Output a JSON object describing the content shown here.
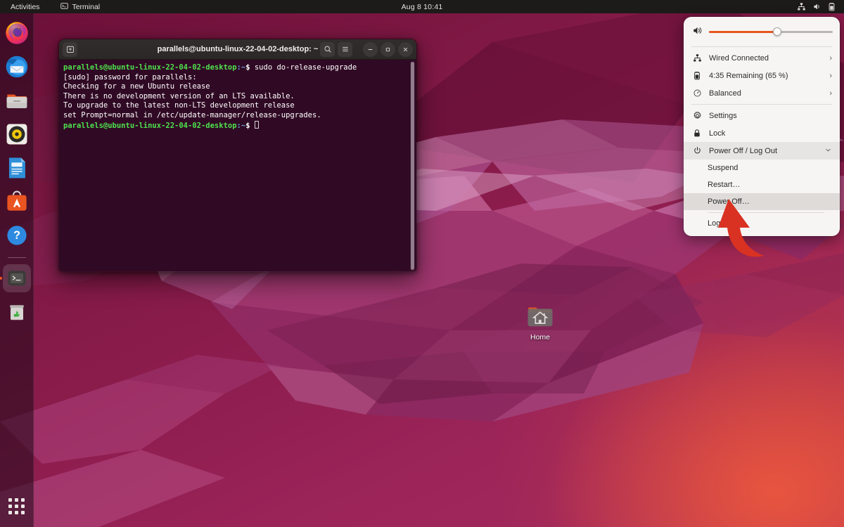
{
  "topbar": {
    "activities": "Activities",
    "app_name": "Terminal",
    "clock": "Aug 8  10:41",
    "tray_icons": [
      "network-wired-icon",
      "volume-icon",
      "battery-icon"
    ]
  },
  "dock": {
    "items": [
      {
        "name": "firefox",
        "label": "Firefox",
        "running": false
      },
      {
        "name": "thunderbird",
        "label": "Thunderbird Mail",
        "running": false
      },
      {
        "name": "files",
        "label": "Files",
        "running": false
      },
      {
        "name": "rhythmbox",
        "label": "Rhythmbox",
        "running": false
      },
      {
        "name": "libreoffice-writer",
        "label": "LibreOffice Writer",
        "running": false
      },
      {
        "name": "ubuntu-software",
        "label": "Ubuntu Software",
        "running": false
      },
      {
        "name": "help",
        "label": "Help",
        "running": false
      },
      {
        "name": "terminal",
        "label": "Terminal",
        "running": true
      },
      {
        "name": "trash",
        "label": "Trash",
        "running": false
      }
    ],
    "show_apps_label": "Show Applications"
  },
  "terminal": {
    "title": "parallels@ubuntu-linux-22-04-02-desktop: ~",
    "new_tab_label": "+",
    "search_label": "Search",
    "menu_label": "Menu",
    "minimize_label": "–",
    "maximize_label": "□",
    "close_label": "×",
    "prompt_user": "parallels@ubuntu-linux-22-04-02-desktop",
    "prompt_path": ":~",
    "prompt_symbol": "$",
    "lines": [
      {
        "type": "prompt",
        "command": " sudo do-release-upgrade"
      },
      {
        "type": "plain",
        "text": "[sudo] password for parallels:"
      },
      {
        "type": "plain",
        "text": "Checking for a new Ubuntu release"
      },
      {
        "type": "plain",
        "text": "There is no development version of an LTS available."
      },
      {
        "type": "plain",
        "text": "To upgrade to the latest non-LTS development release"
      },
      {
        "type": "plain",
        "text": "set Prompt=normal in /etc/update-manager/release-upgrades."
      },
      {
        "type": "prompt",
        "command": " ",
        "cursor": true
      }
    ]
  },
  "desktop": {
    "home_icon_label": "Home"
  },
  "sysmenu": {
    "volume": {
      "icon": "volume-icon",
      "value": 55
    },
    "rows": [
      {
        "name": "wired",
        "icon": "network-wired-icon",
        "label": "Wired Connected",
        "chevron": "›"
      },
      {
        "name": "battery",
        "icon": "battery-icon",
        "label": "4:35 Remaining (65 %)",
        "chevron": "›"
      },
      {
        "name": "power-profile",
        "icon": "power-profile-icon",
        "label": "Balanced",
        "chevron": "›"
      }
    ],
    "rows2": [
      {
        "name": "settings",
        "icon": "gear-icon",
        "label": "Settings"
      },
      {
        "name": "lock",
        "icon": "lock-icon",
        "label": "Lock"
      }
    ],
    "power_menu": {
      "name": "power-off-log-out",
      "icon": "power-icon",
      "label": "Power Off / Log Out",
      "chevron": "⌄",
      "expanded": true,
      "items": [
        {
          "name": "suspend",
          "label": "Suspend",
          "active": false
        },
        {
          "name": "restart",
          "label": "Restart…",
          "active": false
        },
        {
          "name": "power-off",
          "label": "Power Off…",
          "active": true
        },
        {
          "name": "log-out",
          "label": "Log Out…",
          "active": false
        }
      ]
    }
  },
  "annotation": {
    "arrow_color": "#d93222",
    "points_to": "power-off"
  },
  "colors": {
    "accent": "#e95420",
    "terminal_bg": "#300a24",
    "topbar_bg": "#1d1b1a",
    "menu_bg": "#f6f5f4"
  }
}
